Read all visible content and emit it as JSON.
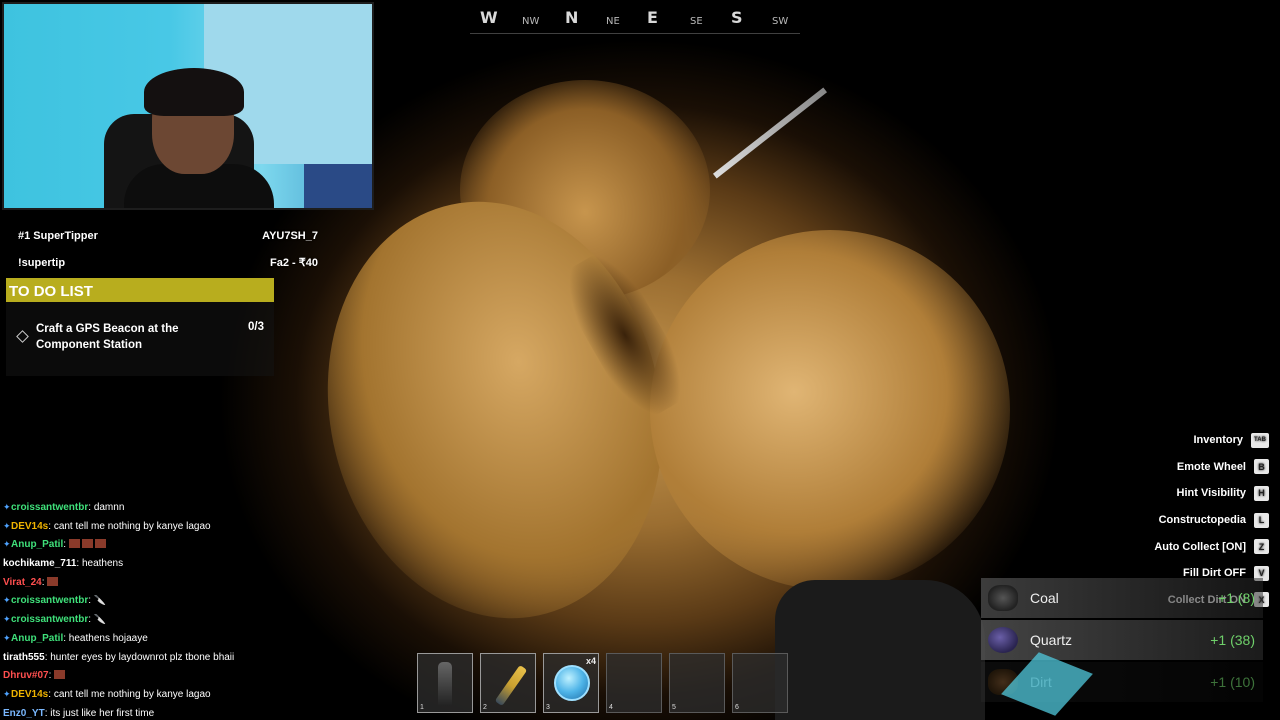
{
  "compass": {
    "marks": [
      "W",
      "NW",
      "N",
      "NE",
      "E",
      "SE",
      "S",
      "SW"
    ]
  },
  "tipper": {
    "rows": [
      {
        "label": "#1 SuperTipper",
        "value": "AYU7SH_7"
      },
      {
        "label": "!supertip",
        "value": "Fa2 - ₹40"
      }
    ]
  },
  "todo": {
    "header": "TO DO LIST",
    "task": "Craft a GPS Beacon at the Component Station",
    "count": "0/3"
  },
  "chat": [
    {
      "user": "croissantwentbr",
      "color": "#3fe07a",
      "message": "damnn",
      "emotes": 0
    },
    {
      "user": "DEV14s",
      "color": "#f0b400",
      "message": "cant tell me nothing by kanye lagao",
      "emotes": 0
    },
    {
      "user": "Anup_Patil",
      "color": "#3fe07a",
      "message": "",
      "emotes": 3
    },
    {
      "user": "kochikame_711",
      "color": "#ffffff",
      "message": "heathens",
      "emotes": 0
    },
    {
      "user": "Virat_24",
      "color": "#ff4f4f",
      "message": "",
      "emotes": 1
    },
    {
      "user": "croissantwentbr",
      "color": "#3fe07a",
      "message": "🔪",
      "emotes": 0
    },
    {
      "user": "croissantwentbr",
      "color": "#3fe07a",
      "message": "🔪",
      "emotes": 0
    },
    {
      "user": "Anup_Patil",
      "color": "#3fe07a",
      "message": "heathens hojaaye",
      "emotes": 0
    },
    {
      "user": "tirath555",
      "color": "#ffffff",
      "message": "hunter eyes by laydownrot plz tbone bhaii",
      "emotes": 0
    },
    {
      "user": "Dhruv#07",
      "color": "#ff4f4f",
      "message": "",
      "emotes": 1
    },
    {
      "user": "DEV14s",
      "color": "#f0b400",
      "message": "cant tell me nothing by kanye lagao",
      "emotes": 0
    },
    {
      "user": "Enz0_YT",
      "color": "#7ab8ff",
      "message": "its just like her first time",
      "emotes": 0
    }
  ],
  "hotbar": {
    "slots": [
      {
        "number": "1",
        "item": "axe",
        "qty": ""
      },
      {
        "number": "2",
        "item": "drill",
        "qty": ""
      },
      {
        "number": "3",
        "item": "orb",
        "qty": "x4"
      },
      {
        "number": "4",
        "item": "",
        "qty": ""
      },
      {
        "number": "5",
        "item": "",
        "qty": ""
      },
      {
        "number": "6",
        "item": "",
        "qty": ""
      }
    ]
  },
  "hints": [
    {
      "label": "Inventory",
      "key": "TAB"
    },
    {
      "label": "Emote Wheel",
      "key": "B"
    },
    {
      "label": "Hint Visibility",
      "key": "H"
    },
    {
      "label": "Constructopedia",
      "key": "L"
    },
    {
      "label": "Auto Collect [ON]",
      "key": "Z"
    },
    {
      "label": "Fill Dirt OFF",
      "key": "V"
    },
    {
      "label": "Collect Dirt ON",
      "key": "X"
    }
  ],
  "collected": [
    {
      "name": "Coal",
      "delta": "+1 (8)",
      "icon": "coal-icon"
    },
    {
      "name": "Quartz",
      "delta": "+1 (38)",
      "icon": "quartz-icon"
    },
    {
      "name": "Dirt",
      "delta": "+1 (10)",
      "icon": "dirt-icon"
    }
  ]
}
